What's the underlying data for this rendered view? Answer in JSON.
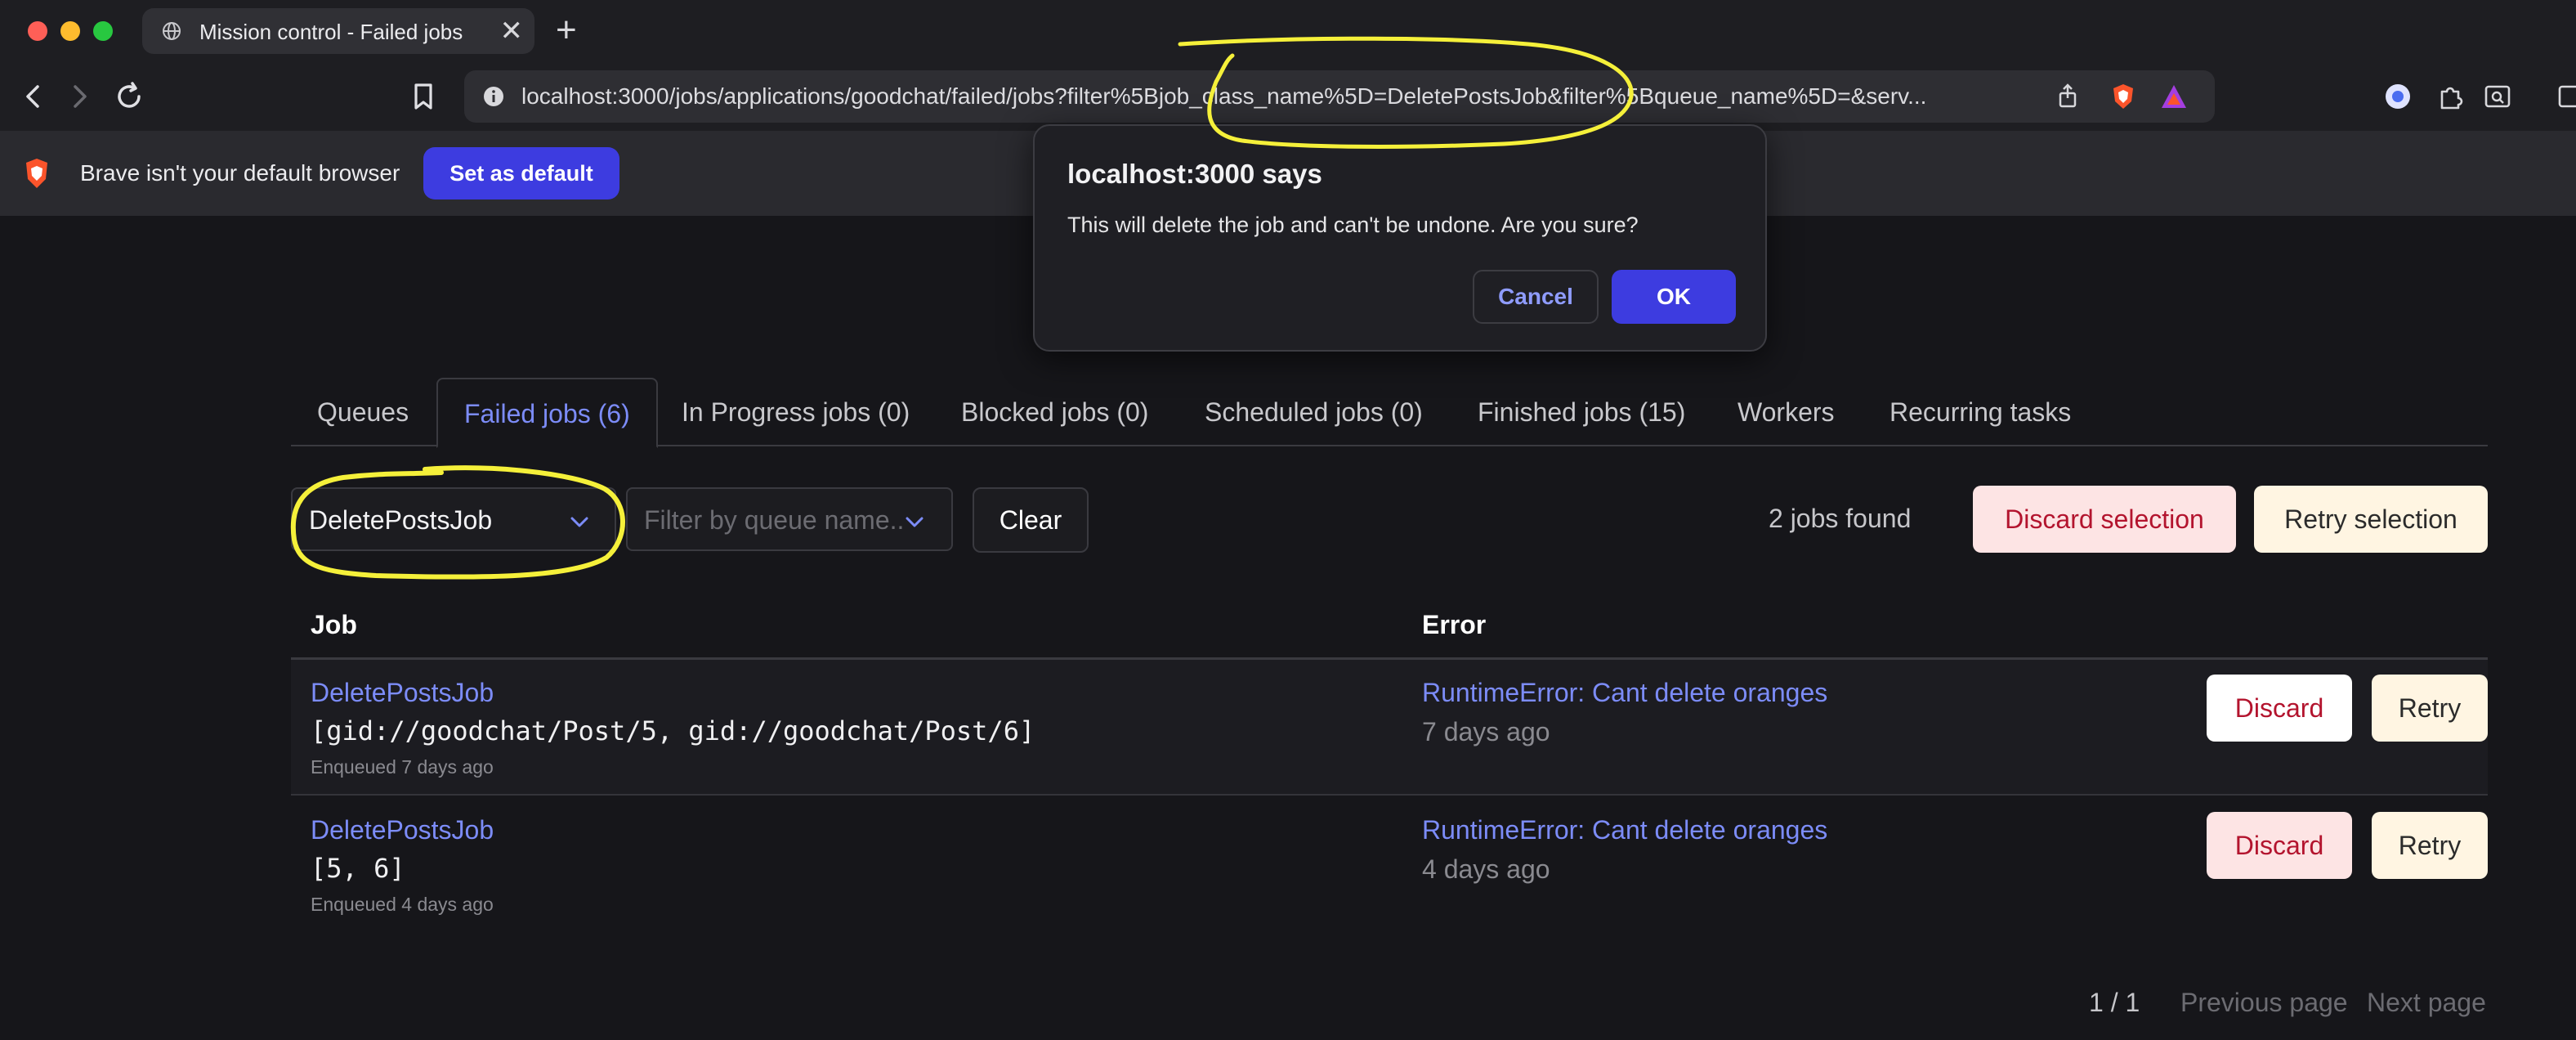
{
  "browser": {
    "tab_title": "Mission control - Failed jobs",
    "tab_close": "✕",
    "new_tab": "+",
    "url": "localhost:3000/jobs/applications/goodchat/failed/jobs?filter%5Bjob_class_name%5D=DeletePostsJob&filter%5Bqueue_name%5D=&serv..."
  },
  "infobar": {
    "message": "Brave isn't your default browser",
    "button_label": "Set as default"
  },
  "dialog": {
    "title": "localhost:3000 says",
    "message": "This will delete the job and can't be undone. Are you sure?",
    "cancel_label": "Cancel",
    "ok_label": "OK"
  },
  "tabs": [
    {
      "label": "Queues"
    },
    {
      "label": "Failed jobs (6)"
    },
    {
      "label": "In Progress jobs (0)"
    },
    {
      "label": "Blocked jobs (0)"
    },
    {
      "label": "Scheduled jobs (0)"
    },
    {
      "label": "Finished jobs (15)"
    },
    {
      "label": "Workers"
    },
    {
      "label": "Recurring tasks"
    }
  ],
  "filters": {
    "job_class_value": "DeletePostsJob",
    "queue_placeholder": "Filter by queue name...",
    "clear_label": "Clear"
  },
  "summary": {
    "jobs_found": "2 jobs found",
    "discard_selection": "Discard selection",
    "retry_selection": "Retry selection"
  },
  "table": {
    "headers": {
      "job": "Job",
      "error": "Error"
    },
    "rows": [
      {
        "job_class": "DeletePostsJob",
        "args": "[gid://goodchat/Post/5, gid://goodchat/Post/6]",
        "enqueued": "Enqueued 7 days ago",
        "error": "RuntimeError: Cant delete oranges",
        "error_time": "7 days ago",
        "discard_label": "Discard",
        "retry_label": "Retry"
      },
      {
        "job_class": "DeletePostsJob",
        "args": "[5, 6]",
        "enqueued": "Enqueued 4 days ago",
        "error": "RuntimeError: Cant delete oranges",
        "error_time": "4 days ago",
        "discard_label": "Discard",
        "retry_label": "Retry"
      }
    ]
  },
  "pagination": {
    "page": "1 / 1",
    "previous": "Previous page",
    "next": "Next page"
  },
  "colors": {
    "accent": "#7c8cf8",
    "primary_button": "#3d3ce0",
    "annotation": "#f5f03a"
  }
}
